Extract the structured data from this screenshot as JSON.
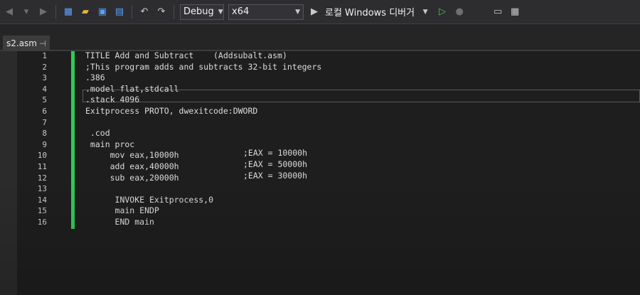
{
  "toolbar": {
    "config": "Debug",
    "platform": "x64",
    "run_label": "로컬 Windows 디버거"
  },
  "tab": {
    "title": "s2.asm",
    "pin": "⊣"
  },
  "editor": {
    "line_numbers": [
      "1",
      "2",
      "3",
      "4",
      "5",
      "6",
      "7",
      "8",
      "9",
      "10",
      "11",
      "12",
      "13",
      "14",
      "15",
      "16"
    ],
    "lines": [
      "TITLE Add and Subtract    (Addsubalt.asm)",
      ";This program adds and subtracts 32-bit integers",
      ".386",
      ".model flat,stdcall",
      ".stack 4096",
      "Exitprocess PROTO, dwexitcode:DWORD",
      "",
      " .cod",
      " main proc",
      "     mov eax,10000h",
      "     add eax,40000h",
      "     sub eax,20000h",
      "",
      "      INVOKE Exitprocess,0",
      "      main ENDP",
      "      END main"
    ],
    "comments": [
      {
        "line": 10,
        "text": ";EAX = 10000h"
      },
      {
        "line": 11,
        "text": ";EAX = 50000h"
      },
      {
        "line": 12,
        "text": ";EAX = 30000h"
      }
    ]
  },
  "colors": {
    "change_bar": "#2ecc57",
    "editor_bg": "#1e1e1e",
    "toolbar_bg": "#2d2d30"
  }
}
